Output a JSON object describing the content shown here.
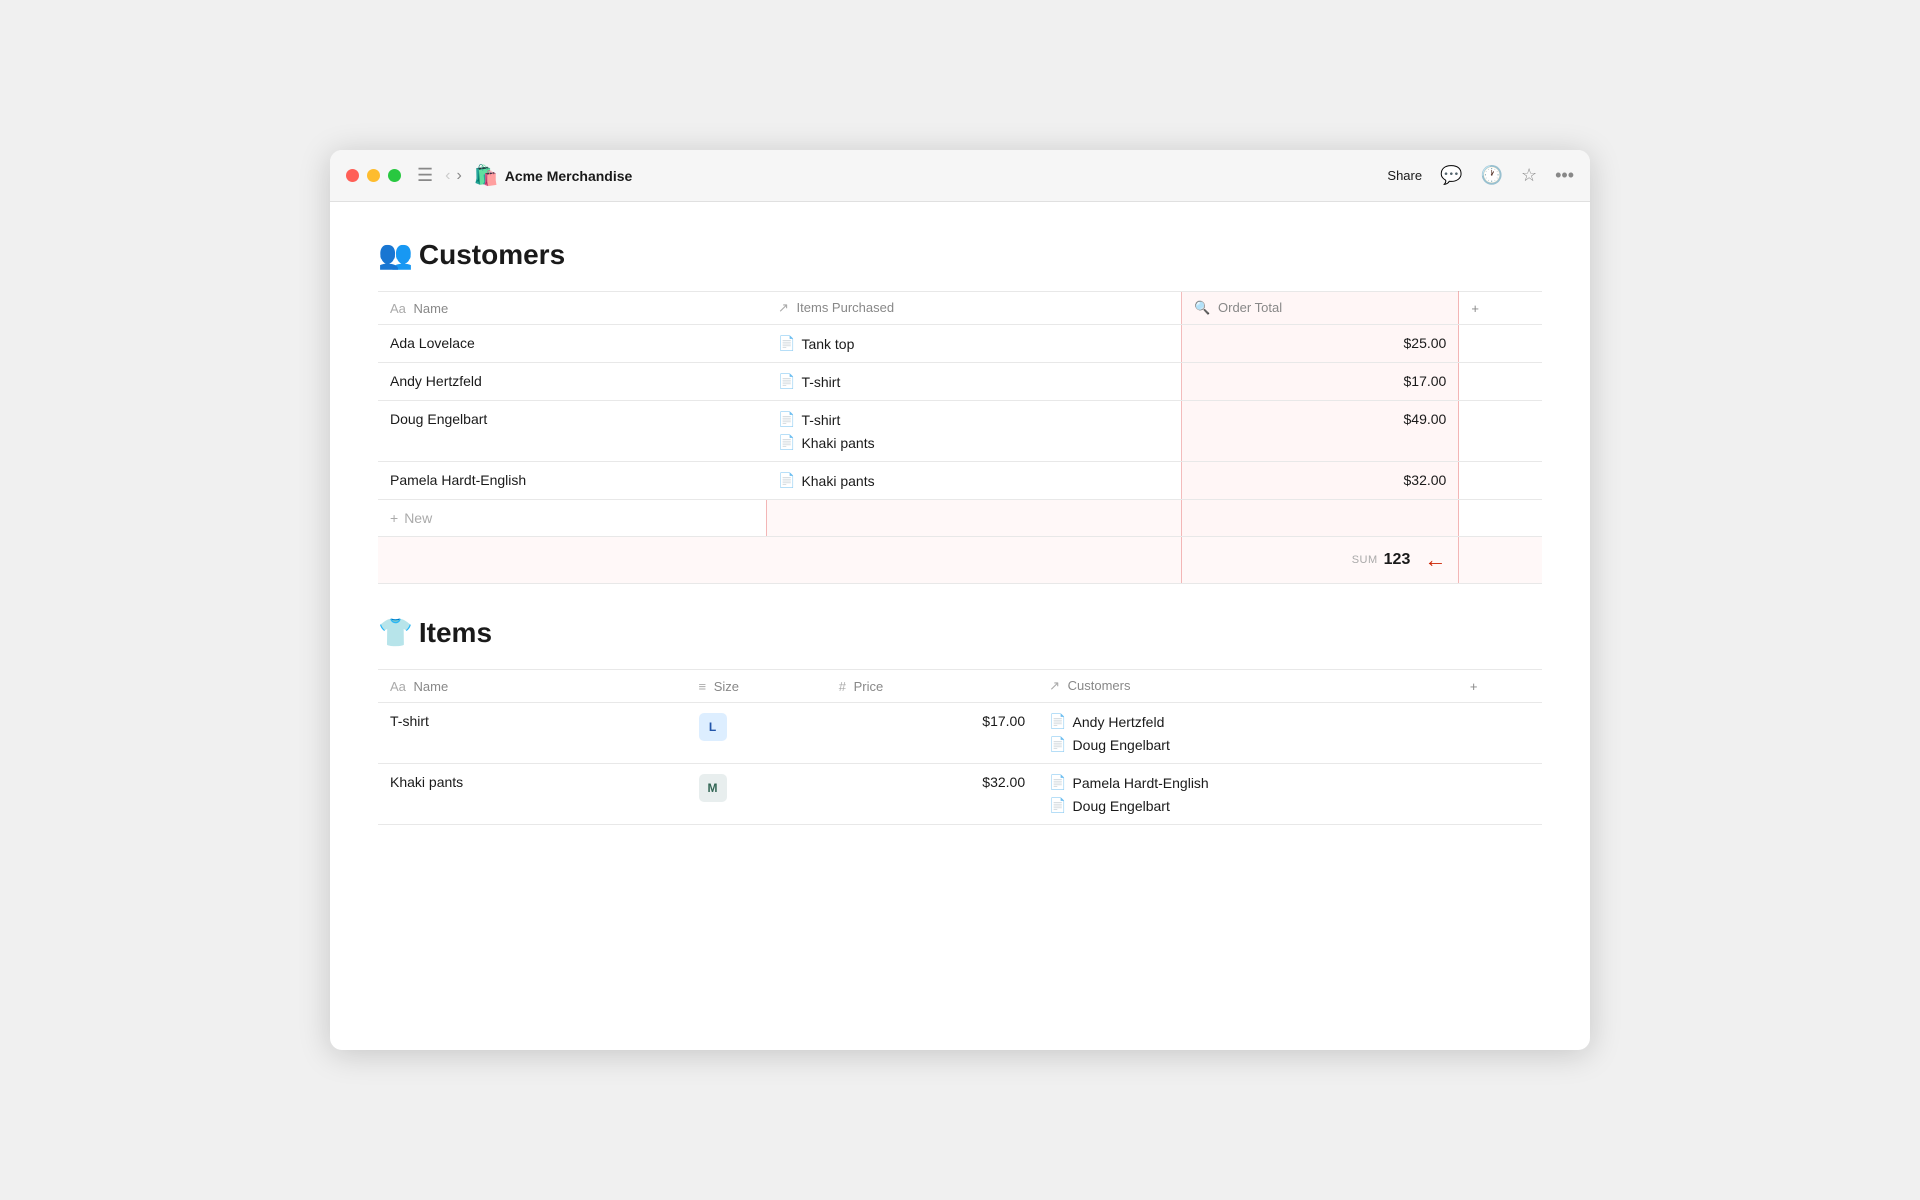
{
  "titlebar": {
    "app_icon": "🛍️",
    "app_title": "Acme Merchandise",
    "share_label": "Share",
    "nav_back_disabled": true,
    "nav_forward_disabled": true
  },
  "customers_section": {
    "icon": "👥",
    "title": "Customers",
    "columns": [
      {
        "icon": "Aa",
        "label": "Name"
      },
      {
        "icon": "↗",
        "label": "Items Purchased"
      },
      {
        "icon": "🔍",
        "label": "Order Total"
      },
      {
        "icon": "+",
        "label": ""
      }
    ],
    "rows": [
      {
        "name": "Ada Lovelace",
        "items": [
          {
            "label": "Tank top"
          }
        ],
        "order_total": "$25.00"
      },
      {
        "name": "Andy Hertzfeld",
        "items": [
          {
            "label": "T-shirt"
          }
        ],
        "order_total": "$17.00"
      },
      {
        "name": "Doug Engelbart",
        "items": [
          {
            "label": "T-shirt"
          },
          {
            "label": "Khaki pants"
          }
        ],
        "order_total": "$49.00"
      },
      {
        "name": "Pamela Hardt-English",
        "items": [
          {
            "label": "Khaki pants"
          }
        ],
        "order_total": "$32.00"
      }
    ],
    "new_label": "New",
    "sum_label": "SUM",
    "sum_value": "123"
  },
  "items_section": {
    "icon": "👕",
    "title": "Items",
    "columns": [
      {
        "icon": "Aa",
        "label": "Name"
      },
      {
        "icon": "≡",
        "label": "Size"
      },
      {
        "icon": "#",
        "label": "Price"
      },
      {
        "icon": "↗",
        "label": "Customers"
      },
      {
        "icon": "+",
        "label": ""
      }
    ],
    "rows": [
      {
        "name": "T-shirt",
        "size": "L",
        "size_class": "l",
        "price": "$17.00",
        "customers": [
          "Andy Hertzfeld",
          "Doug Engelbart"
        ]
      },
      {
        "name": "Khaki pants",
        "size": "M",
        "size_class": "m",
        "price": "$32.00",
        "customers": [
          "Pamela Hardt-English",
          "Doug Engelbart"
        ]
      }
    ]
  }
}
